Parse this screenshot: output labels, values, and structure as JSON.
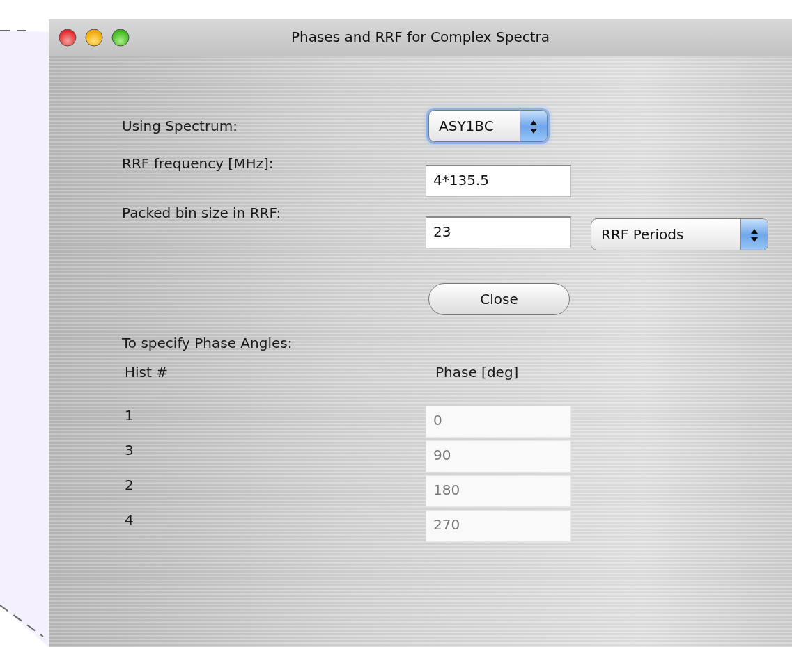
{
  "window": {
    "title": "Phases and RRF for Complex Spectra"
  },
  "form": [
    {
      "kind": "popup",
      "label": "Using Spectrum:",
      "value": "ASY1BC",
      "focused": true
    },
    {
      "kind": "field",
      "label": "RRF frequency [MHz]:",
      "value": "4*135.5"
    },
    {
      "kind": "field_popup",
      "label": "Packed bin size in RRF:",
      "value": "23",
      "unit": "RRF Periods"
    }
  ],
  "close_button": "Close",
  "phase_section": {
    "heading": "To specify Phase Angles:",
    "columns": [
      "Hist #",
      "Phase [deg]"
    ],
    "rows": [
      {
        "hist": "1",
        "phase": "0",
        "disabled": true
      },
      {
        "hist": "3",
        "phase": "90",
        "disabled": true
      },
      {
        "hist": "2",
        "phase": "180",
        "disabled": true
      },
      {
        "hist": "4",
        "phase": "270",
        "disabled": true
      }
    ]
  }
}
